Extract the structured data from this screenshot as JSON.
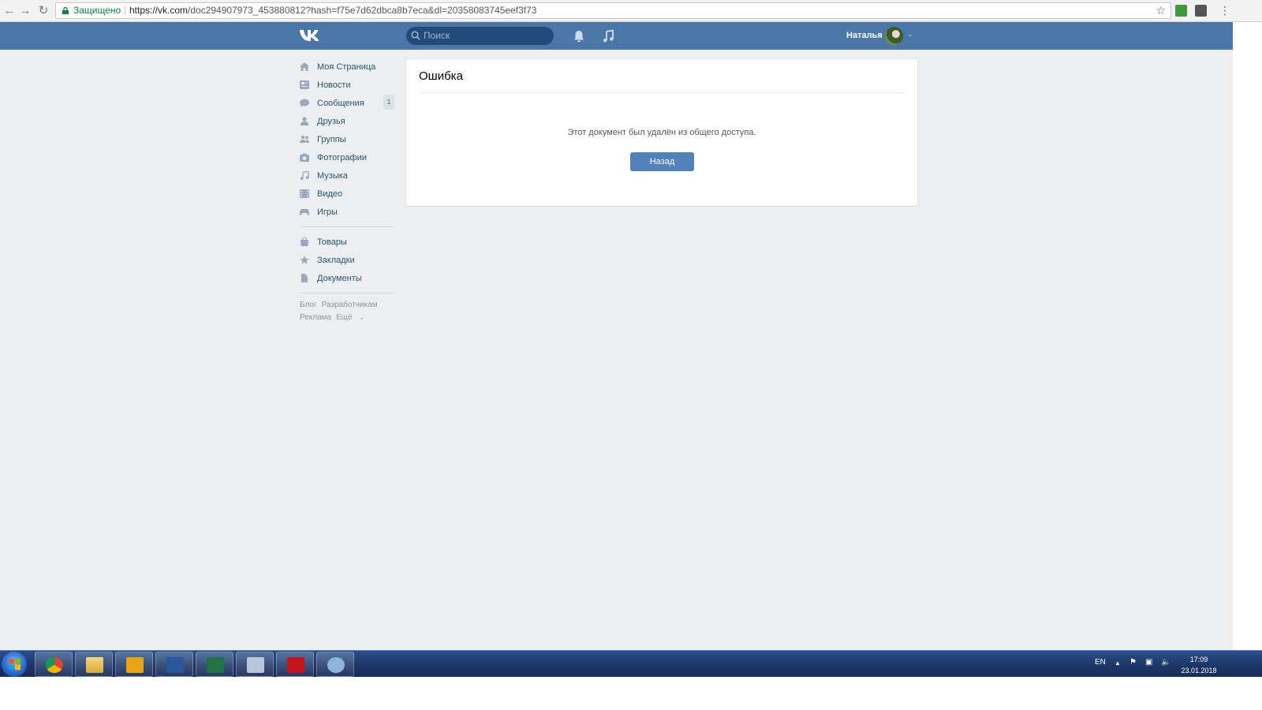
{
  "browser": {
    "secure_label": "Защищено",
    "url_host": "https://vk.com",
    "url_path": "/doc294907973_453880812?hash=f75e7d62dbca8b7eca&dl=20358083745eef3f73"
  },
  "header": {
    "search_placeholder": "Поиск",
    "user_name": "Наталья",
    "bg_color": "#4a76a8"
  },
  "sidebar": {
    "items": [
      {
        "label": "Моя Страница",
        "icon": "home-icon"
      },
      {
        "label": "Новости",
        "icon": "news-icon"
      },
      {
        "label": "Сообщения",
        "icon": "messages-icon",
        "badge": "1"
      },
      {
        "label": "Друзья",
        "icon": "friends-icon"
      },
      {
        "label": "Группы",
        "icon": "groups-icon"
      },
      {
        "label": "Фотографии",
        "icon": "photos-icon"
      },
      {
        "label": "Музыка",
        "icon": "music-icon"
      },
      {
        "label": "Видео",
        "icon": "video-icon"
      },
      {
        "label": "Игры",
        "icon": "games-icon"
      }
    ],
    "items2": [
      {
        "label": "Товары",
        "icon": "market-icon"
      },
      {
        "label": "Закладки",
        "icon": "bookmarks-icon"
      },
      {
        "label": "Документы",
        "icon": "documents-icon"
      }
    ],
    "footer": {
      "blog": "Блог",
      "developers": "Разработчикам",
      "ads": "Реклама",
      "more": "Ещё"
    }
  },
  "main": {
    "title": "Ошибка",
    "message": "Этот документ был удалён из общего доступа.",
    "back_button": "Назад"
  },
  "taskbar": {
    "lang": "EN",
    "time": "17:09",
    "date": "23.01.2018"
  }
}
